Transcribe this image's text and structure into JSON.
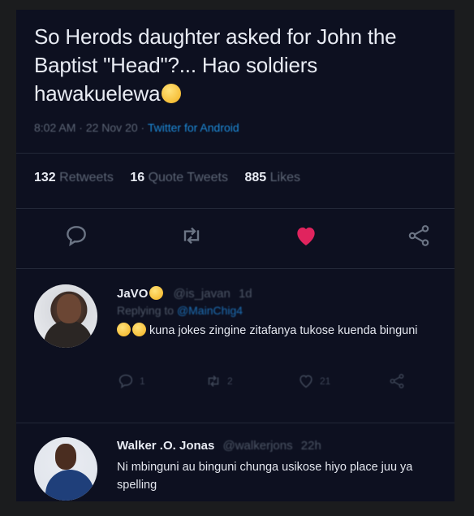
{
  "tweet": {
    "text": "So Herods daughter asked for John the Baptist \"Head\"?... Hao soldiers hawakuelewa",
    "time": "8:02 AM",
    "date": "22 Nov 20",
    "client": "Twitter for Android",
    "retweets": "132",
    "retweets_label": "Retweets",
    "quote_tweets": "16",
    "quote_tweets_label": "Quote Tweets",
    "likes": "885",
    "likes_label": "Likes",
    "colors": {
      "like_active": "#e0245e",
      "link": "#1d9bf0"
    }
  },
  "replies": [
    {
      "name": "JaVO",
      "handle": "@is_javan",
      "age": "1d",
      "replying_prefix": "Replying to",
      "replying_to": "@MainChig4",
      "text": "kuna jokes zingine zitafanya tukose kuenda binguni",
      "reply_count": "1",
      "retweet_count": "2",
      "like_count": "21"
    },
    {
      "name": "Walker .O. Jonas",
      "handle": "@walkerjons",
      "age": "22h",
      "text": "Ni mbinguni au binguni chunga usikose hiyo place juu ya spelling"
    }
  ]
}
